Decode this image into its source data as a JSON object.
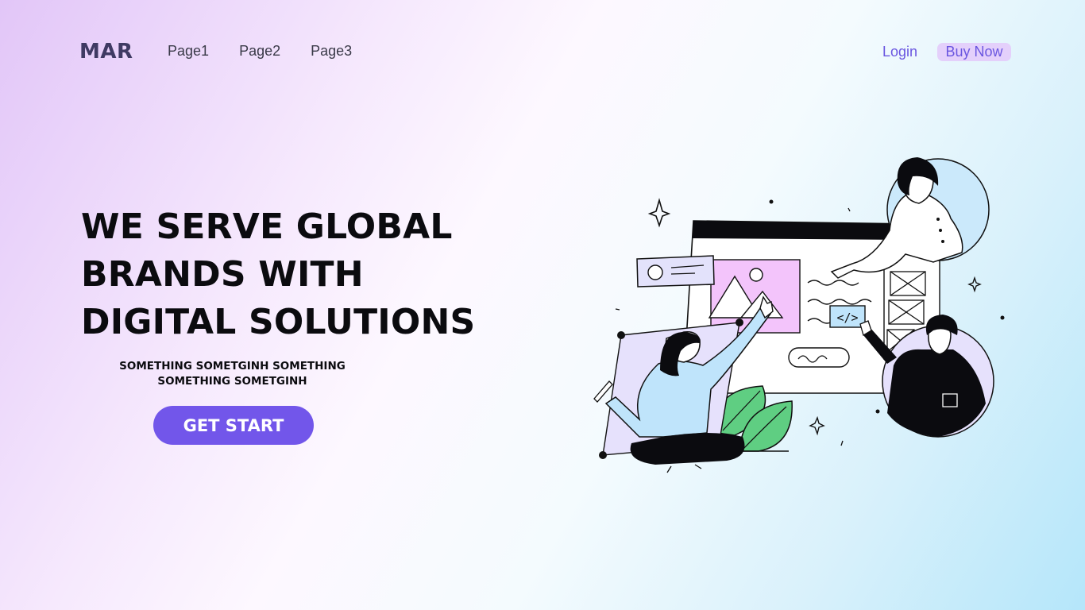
{
  "header": {
    "logo": "MAR",
    "nav": [
      "Page1",
      "Page2",
      "Page3"
    ],
    "login": "Login",
    "buy_now": "Buy Now"
  },
  "hero": {
    "headline": [
      "WE SERVE GLOBAL",
      "BRANDS WITH",
      "DIGITAL SOLUTIONS"
    ],
    "subtitle": [
      "SOMETHING SOMETGINH SOMETHING",
      "SOMETHING SOMETGINH"
    ],
    "cta": "GET START",
    "code_tag": "</>"
  },
  "colors": {
    "accent": "#7256ea",
    "buy_bg": "#e4d0fb",
    "text_dark": "#0b0b0f",
    "logo": "#3f3a63"
  }
}
